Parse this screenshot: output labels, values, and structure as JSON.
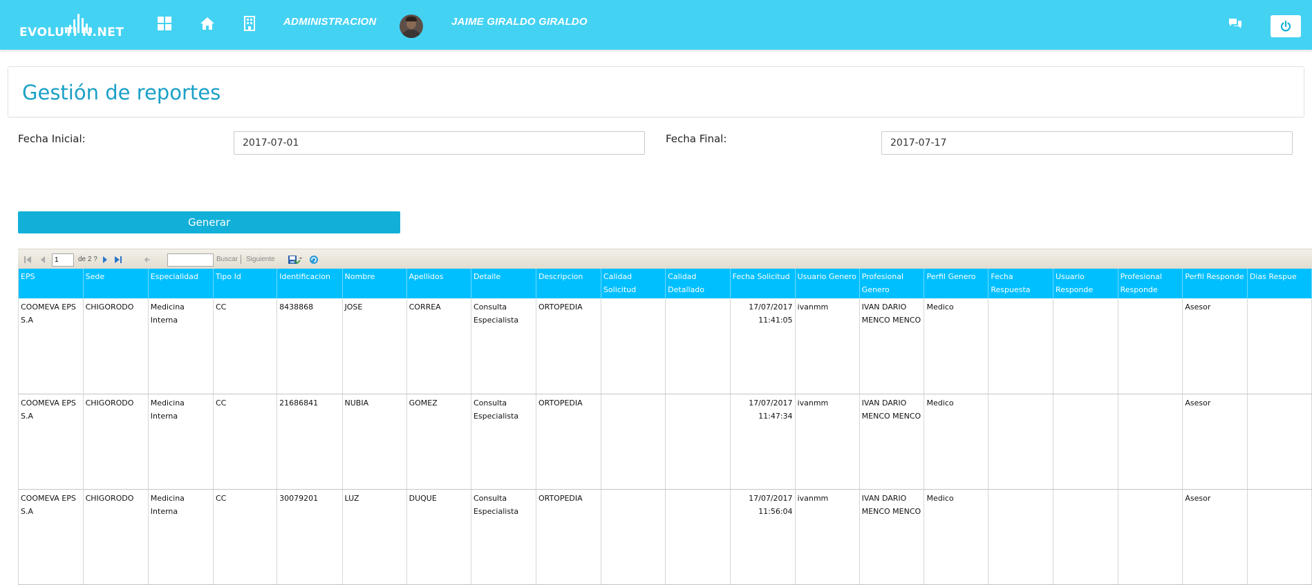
{
  "nav": {
    "logo_text": "EVOLUTI   N.NET",
    "admin_label": "ADMINISTRACION",
    "user_name": "JAIME GIRALDO GIRALDO"
  },
  "page": {
    "title": "Gestión de reportes"
  },
  "filters": {
    "start_label": "Fecha Inicial:",
    "start_value": "2017-07-01",
    "end_label": "Fecha Final:",
    "end_value": "2017-07-17",
    "generate_label": "Generar"
  },
  "toolbar": {
    "page_value": "1",
    "page_of": "de 2 ?",
    "find_label": "Buscar",
    "next_label": "Siguiente"
  },
  "table": {
    "columns": [
      "EPS",
      "Sede",
      "Especialidad",
      "Tipo Id",
      "Identificacion",
      "Nombre",
      "Apellidos",
      "Detalle",
      "Descripcion",
      "Calidad Solicitud",
      "Calidad Detallado",
      "Fecha Solicitud",
      "Usuario Genero",
      "Profesional Genero",
      "Perfil Genero",
      "Fecha Respuesta",
      "Usuario Responde",
      "Profesional Responde",
      "Perfil Responde",
      "Dias Respue"
    ],
    "rows": [
      [
        "COOMEVA EPS S.A",
        "CHIGORODO",
        "Medicina Interna",
        "CC",
        "8438868",
        "JOSE",
        "CORREA",
        "Consulta Especialista",
        "ORTOPEDIA",
        "",
        "",
        "17/07/2017 11:41:05",
        "ivanmm",
        "IVAN DARIO MENCO MENCO",
        "Medico",
        "",
        "",
        "",
        "Asesor",
        ""
      ],
      [
        "COOMEVA EPS S.A",
        "CHIGORODO",
        "Medicina Interna",
        "CC",
        "21686841",
        "NUBIA",
        "GOMEZ",
        "Consulta Especialista",
        "ORTOPEDIA",
        "",
        "",
        "17/07/2017 11:47:34",
        "ivanmm",
        "IVAN DARIO MENCO MENCO",
        "Medico",
        "",
        "",
        "",
        "Asesor",
        ""
      ],
      [
        "COOMEVA EPS S.A",
        "CHIGORODO",
        "Medicina Interna",
        "CC",
        "30079201",
        "LUZ",
        "DUQUE",
        "Consulta Especialista",
        "ORTOPEDIA",
        "",
        "",
        "17/07/2017 11:56:04",
        "ivanmm",
        "IVAN DARIO MENCO MENCO",
        "Medico",
        "",
        "",
        "",
        "Asesor",
        ""
      ]
    ]
  },
  "colors": {
    "topbar": "#44d2f3",
    "title": "#1aa0c7",
    "button": "#12b0d8",
    "table_header": "#00bfff"
  },
  "icons": [
    "windows-icon",
    "home-icon",
    "building-icon",
    "chat-icon",
    "power-icon",
    "first-page-icon",
    "prev-page-icon",
    "next-page-icon",
    "last-page-icon",
    "back-icon",
    "export-icon",
    "refresh-icon"
  ]
}
